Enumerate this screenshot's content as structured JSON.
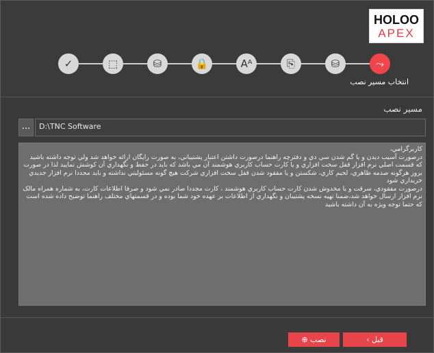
{
  "logo": {
    "line1": "HOLOO",
    "line2": "APEX"
  },
  "steps": {
    "icons": [
      "✓",
      "⬚",
      "⛁",
      "🔒",
      "Aᴬ",
      "⎘",
      "⛁",
      "⤳"
    ],
    "icon_names": [
      "check-icon",
      "select-icon",
      "database-icon",
      "lock-icon",
      "font-icon",
      "copy-icon",
      "database-settings-icon",
      "path-icon"
    ],
    "active_label": "انتخاب مسیر نصب"
  },
  "main": {
    "path_title": "مسير نصب",
    "browse_label": "...",
    "path_value": "D:\\TNC Software",
    "description": "کاربرگرامي،\nدرصورت آسيب ديدن و يا گم شدن سي دي و دفترچه راهنما درصورت داشتن اعتبار پشتيباني، به صورت رايگان ارائه خواهد شد ولي توجه داشته باشيد که قسمت اصلي نرم افزار  قفل سخت افزاري  و يا کارت حساب کاربري هوشمند  آن مي باشد که  بايد در حفظ  و  نگهداري آن کوشش نماييد لذا در  صورت بروز هرگونه صدمه ظاهري، لحيم کاري، شکستن و يا مفقود شدن قفل سخت افزاري شرکت هيچ گونه مسئوليتي نداشته و بايد مجددا نرم افزار جديدي خريداري شود\nدرصورت مفقودي، سرقت و يا مخدوش شدن کارت حساب کاربري هوشمند ، کارت مجددا صادر نمي شود و صرفا اطلاعات کارت، به شماره همراه مالک نرم افزار ارسال خواهد شد،ضمنا تهيه نسخه پشتيبان و نگهداري از اطلاعات بر عهده خود شما بوده و در قسمتهاي مختلف راهنما توضيح داده شده است که حتما توجه ويژه به آن داشته باشيد"
  },
  "footer": {
    "back_label": "قبل",
    "back_icon": "‹",
    "install_label": "نصب",
    "install_icon": "⊕"
  }
}
